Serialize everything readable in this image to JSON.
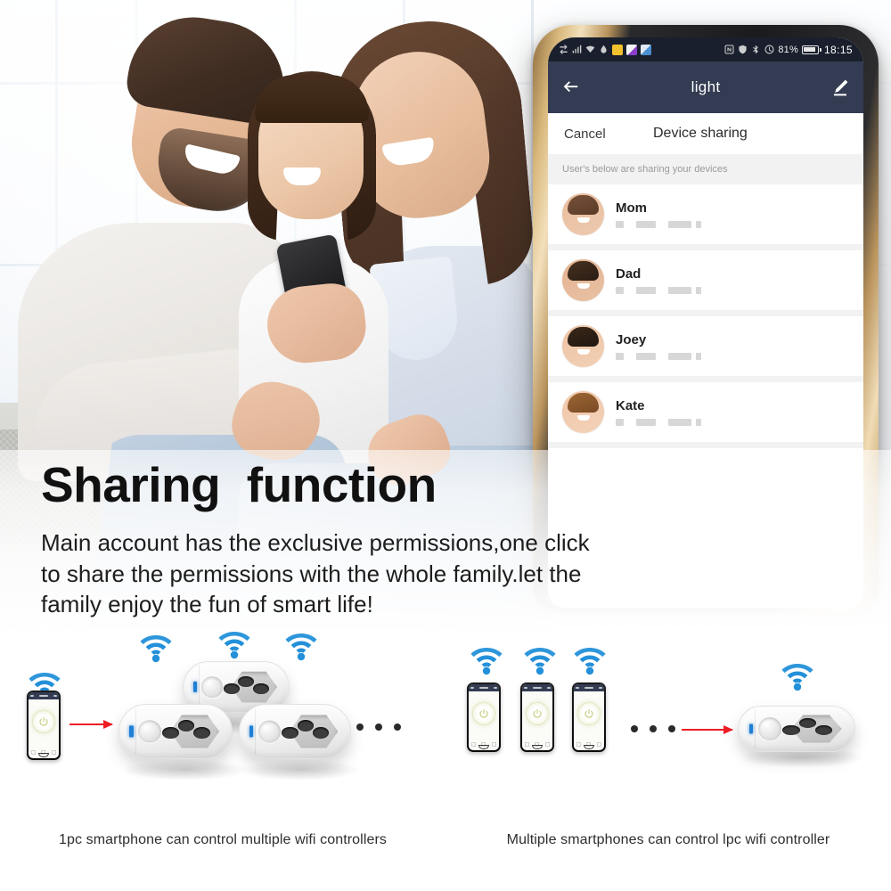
{
  "hero": {
    "headline": "Sharing  function",
    "subcopy": "Main account has the exclusive permissions,one click\nto share the permissions with the whole family.let the\nfamily enjoy the fun of smart life!"
  },
  "phone": {
    "status_bar": {
      "battery_percent": "81%",
      "time": "18:15",
      "icons_left": [
        "sync-icon",
        "signal-icon",
        "wifi-icon",
        "droplet-icon",
        "app-yellow-icon",
        "app-purple-icon",
        "app-blue-icon"
      ],
      "icons_right": [
        "nfc-icon",
        "shield-icon",
        "bluetooth-icon",
        "alarm-icon"
      ]
    },
    "navbar": {
      "back_icon": "back-arrow-icon",
      "title": "light",
      "edit_icon": "pencil-edit-icon"
    },
    "sheet": {
      "cancel_label": "Cancel",
      "title": "Device sharing",
      "subtitle": "User's below are sharing your devices"
    },
    "users": [
      {
        "name": "Mom",
        "phone_masked": "+00  0000  00000 0",
        "skin": "#e9bc9b",
        "hair": "#5a3b28",
        "hair2": "#76513a"
      },
      {
        "name": "Dad",
        "phone_masked": "+00  0000  00000 0",
        "skin": "#e3b28e",
        "hair": "#2b1d14",
        "hair2": "#46301f"
      },
      {
        "name": "Joey",
        "phone_masked": "+00  0000  00000 0",
        "skin": "#eec3a2",
        "hair": "#21160f",
        "hair2": "#3a281a"
      },
      {
        "name": "Kate",
        "phone_masked": "+00  0000  00000 0",
        "skin": "#f0c6a7",
        "hair": "#7a4a24",
        "hair2": "#9c6634"
      }
    ]
  },
  "diagram": {
    "left": {
      "caption": "1pc smartphone can control multiple wifi controllers",
      "phone_count": 1,
      "plug_count": 3,
      "wifi_count": 4,
      "ellipsis": "• • •",
      "arrow_direction": "right",
      "flow": "phone-to-plugs"
    },
    "right": {
      "caption": "Multiple smartphones can control lpc wifi controller",
      "phone_count": 3,
      "plug_count": 1,
      "wifi_count": 4,
      "ellipsis": "• • •",
      "arrow_direction": "right",
      "flow": "phones-to-plug"
    }
  },
  "colors": {
    "navbar": "#333c52",
    "statusbar": "#191f2c",
    "arrow_red": "#ee1c25",
    "wifi_blue": "#1f8fd6",
    "bezel_gold": "#d9b87c",
    "page_bg": "#ffffff"
  }
}
